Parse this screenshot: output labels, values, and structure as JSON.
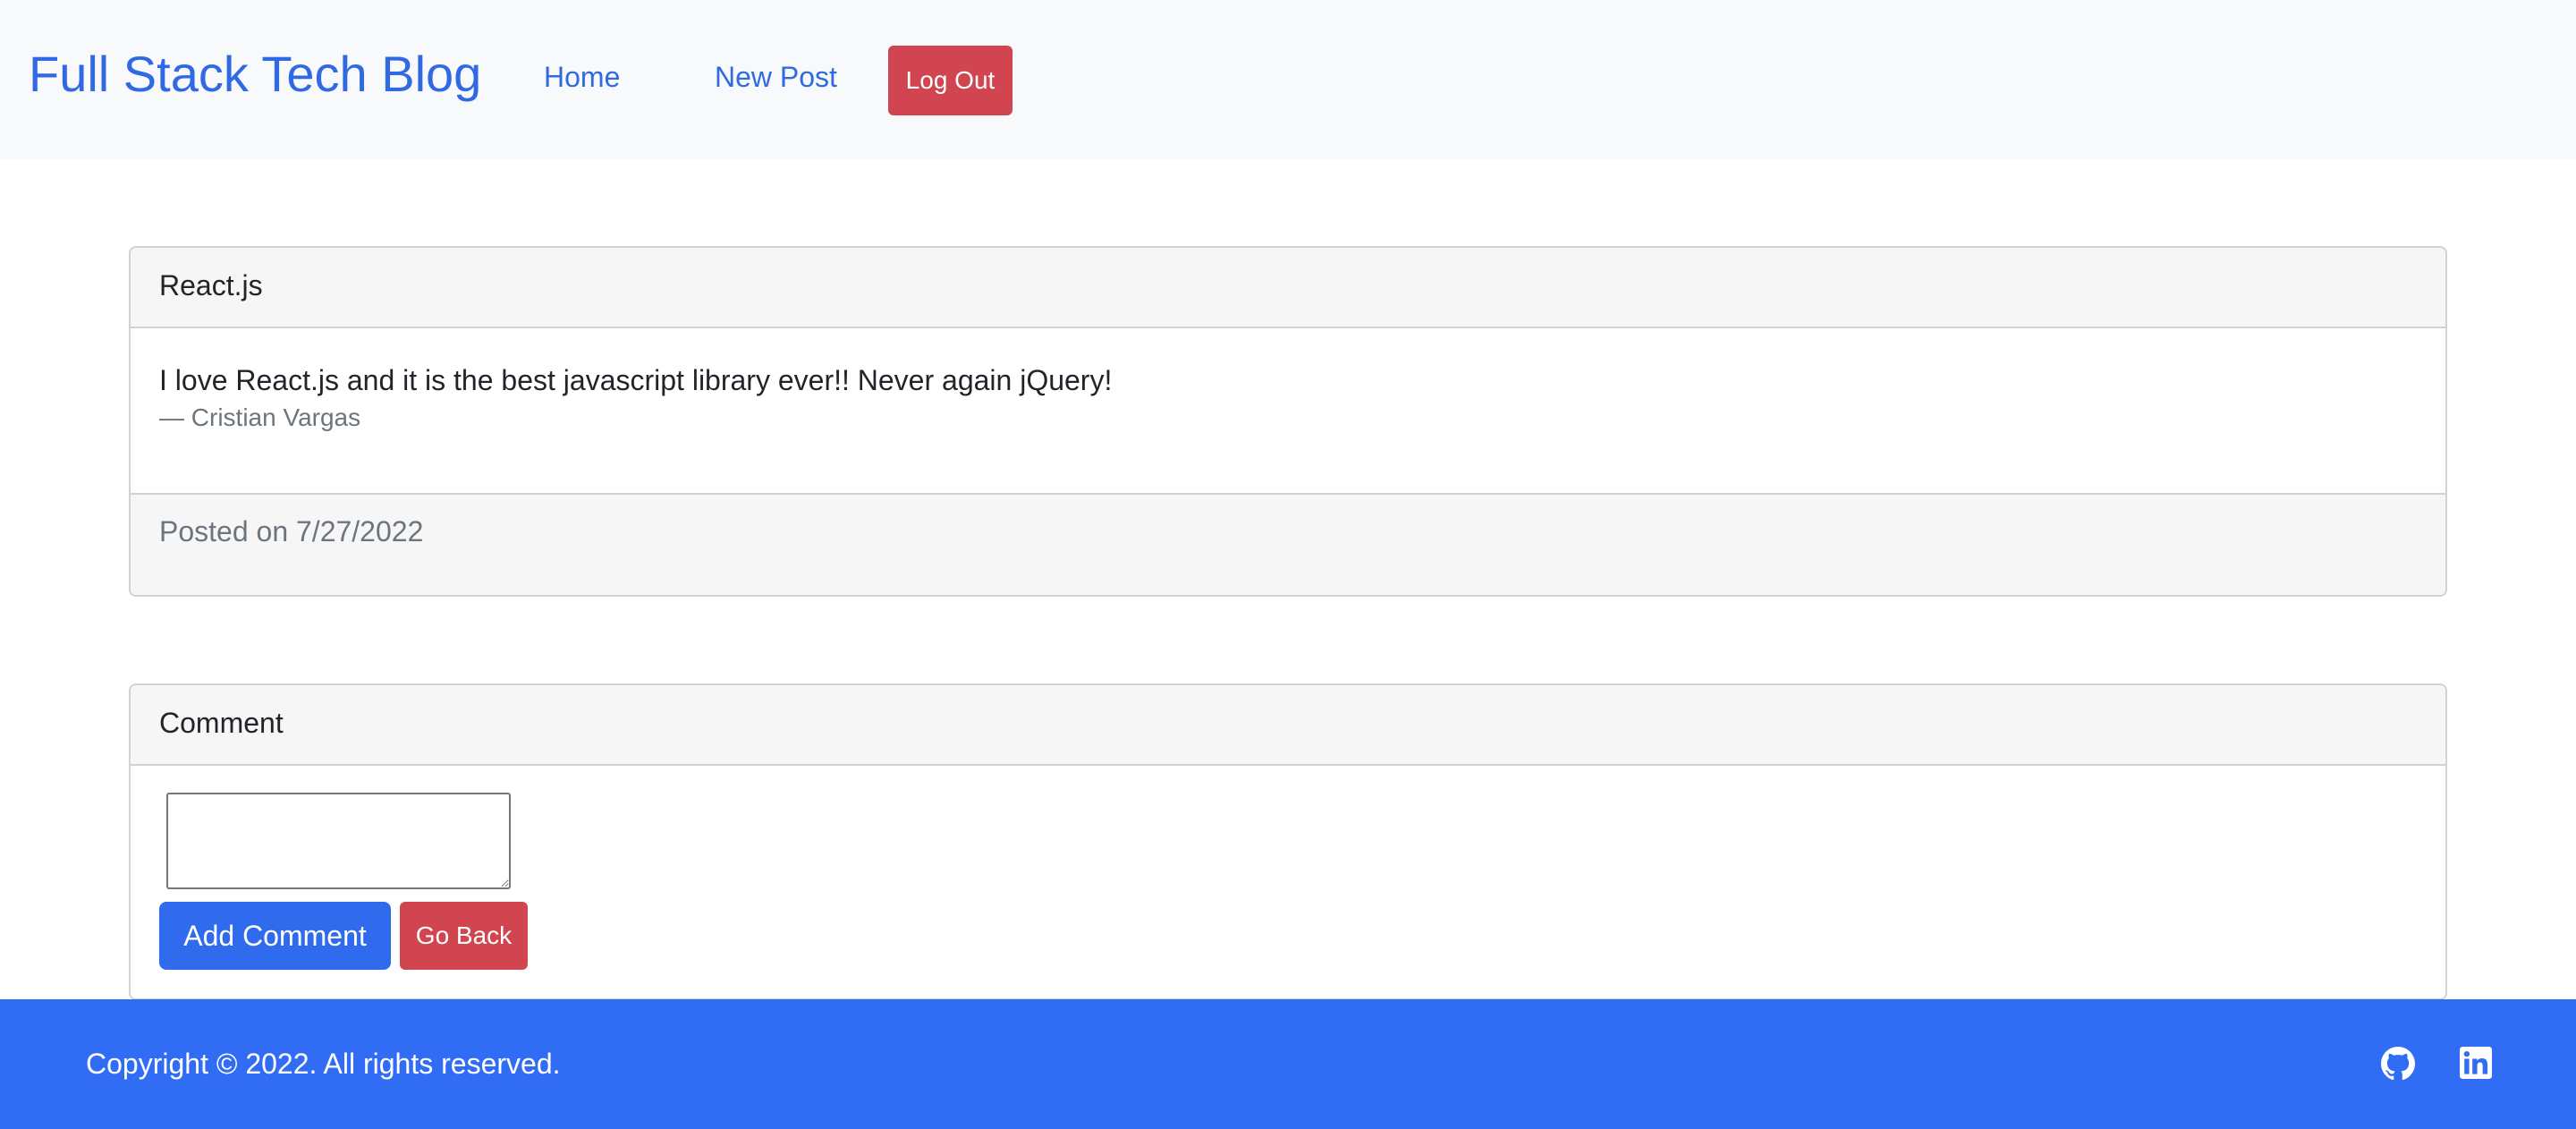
{
  "navbar": {
    "brand": "Full Stack Tech Blog",
    "links": [
      {
        "label": "Home"
      },
      {
        "label": "New Post"
      }
    ],
    "logout_label": "Log Out"
  },
  "post": {
    "title": "React.js",
    "body": "I love React.js and it is the best javascript library ever!! Never again jQuery!",
    "author": "— Cristian Vargas",
    "posted_on": "Posted on 7/27/2022"
  },
  "comment": {
    "header": "Comment",
    "textarea_value": "",
    "textarea_placeholder": "",
    "add_button_label": "Add Comment",
    "back_button_label": "Go Back"
  },
  "footer": {
    "copyright": "Copyright © 2022. All rights reserved.",
    "icons": [
      "github-icon",
      "linkedin-icon"
    ]
  },
  "colors": {
    "brand_blue": "#3169e4",
    "primary_button": "#2f6bec",
    "danger_button": "#d0454f",
    "footer_bg": "#316df4",
    "navbar_bg": "#f8f9fa",
    "card_header_bg": "#f6f6f6",
    "muted_text": "#6c757d"
  }
}
